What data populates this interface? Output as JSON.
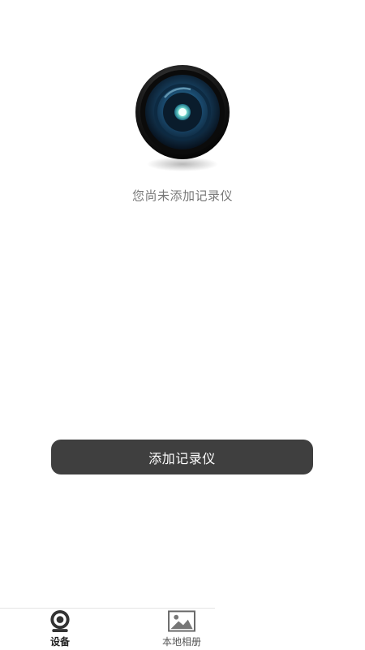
{
  "empty_state": {
    "icon": "camera-lens-icon",
    "message": "您尚未添加记录仪"
  },
  "actions": {
    "add_recorder_label": "添加记录仪"
  },
  "tab_bar": {
    "active_tab": "devices",
    "tabs": [
      {
        "id": "devices",
        "label": "设备",
        "icon": "webcam-icon"
      },
      {
        "id": "album",
        "label": "本地相册",
        "icon": "image-icon"
      }
    ]
  },
  "colors": {
    "button_bg": "#3f3f3f",
    "button_text": "#ffffff",
    "secondary_text": "#777777",
    "background": "#ffffff"
  }
}
